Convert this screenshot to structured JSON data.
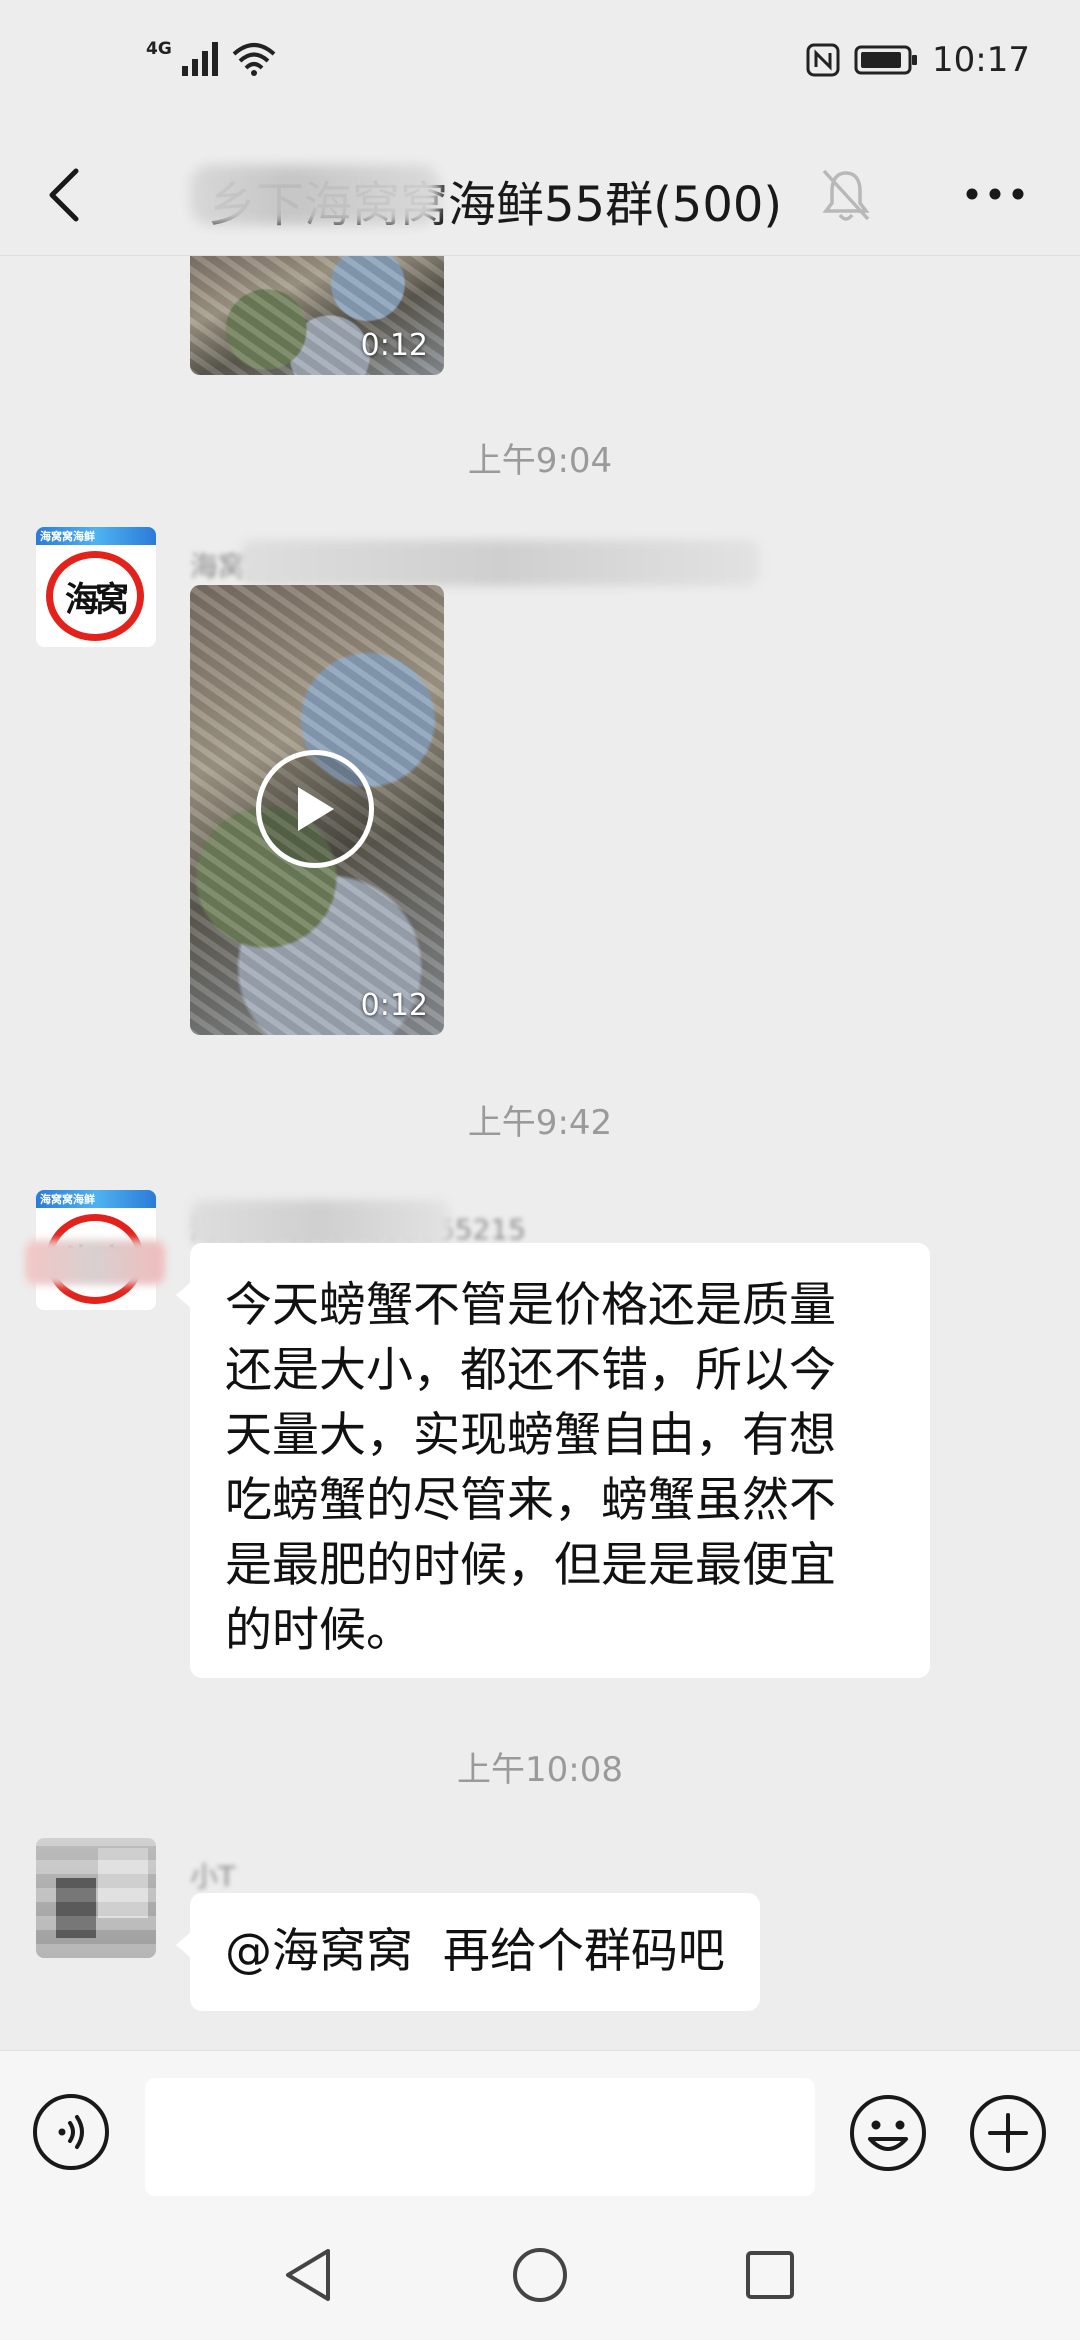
{
  "status_bar": {
    "network": "4G",
    "time": "10:17"
  },
  "header": {
    "title": "乡下海窝窝海鲜55群(500)",
    "back_icon": "chevron-left-icon",
    "mute_icon": "bell-off-icon",
    "more_icon": "more-dots-icon"
  },
  "messages": {
    "video1": {
      "duration": "0:12"
    },
    "time1": "上午9:04",
    "msg2": {
      "sender": "海窝窝海鲜15318855215",
      "video_duration": "0:12"
    },
    "time2": "上午9:42",
    "msg3": {
      "sender": "海窝窝海鲜15318855215",
      "text": "今天螃蟹不管是价格还是质量\n还是大小，都还不错，所以今\n天量大，实现螃蟹自由，有想\n吃螃蟹的尽管来，螃蟹虽然不\n是最肥的时候，但是是最便宜\n的时候。"
    },
    "time3": "上午10:08",
    "msg4": {
      "sender": "小T",
      "text": "@海窝窝  再给个群码吧"
    }
  },
  "avatar_brand": {
    "banner": "海窝窝海鲜",
    "logo_text": "海窝"
  },
  "input_bar": {
    "value": "",
    "voice_icon": "voice-icon",
    "emoji_icon": "emoji-icon",
    "plus_icon": "plus-icon"
  },
  "system_nav": {
    "back_icon": "triangle-back-icon",
    "home_icon": "circle-home-icon",
    "recent_icon": "square-recent-icon"
  },
  "colors": {
    "background": "#ededed",
    "bubble": "#ffffff",
    "brand_red": "#e3231b"
  }
}
